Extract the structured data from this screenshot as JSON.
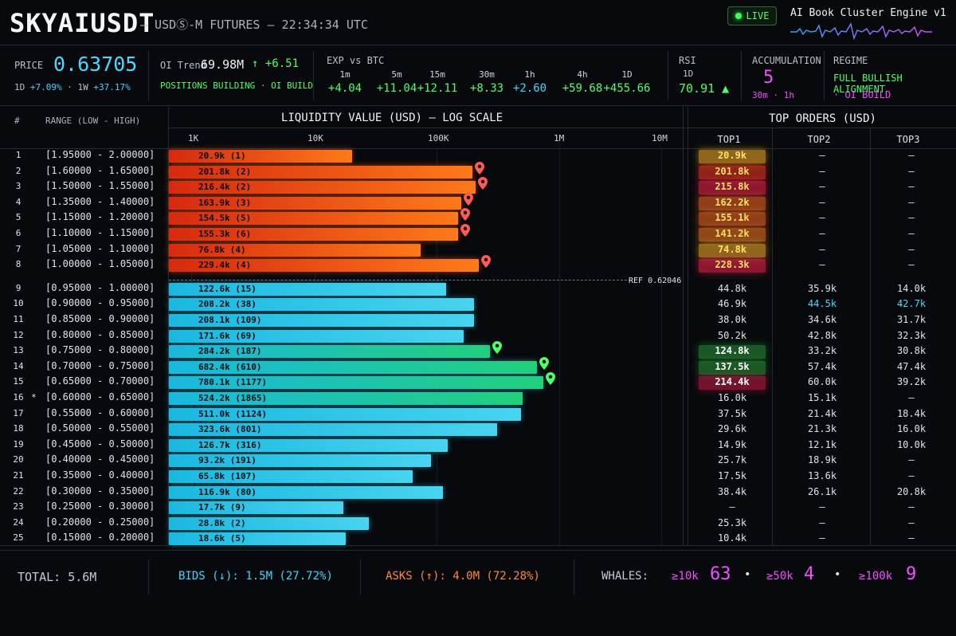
{
  "header": {
    "symbol": "SKYAIUSDT",
    "subtitle": "— USDⓈ-M FUTURES — 22:34:34 UTC",
    "live": "LIVE",
    "engine": "AI Book Cluster Engine v1"
  },
  "stats": {
    "price_label": "PRICE",
    "price": "0.63705",
    "change_1d_label": "1D",
    "change_1d": "+7.09%",
    "change_1w_label": "1W",
    "change_1w": "+37.17%",
    "oi_label": "OI Trend",
    "oi_value": "69.98M",
    "oi_delta": "↑ +6.51",
    "oi_status": "POSITIONS BUILDING · OI BUILD",
    "exp_label": "EXP vs BTC",
    "exp": [
      {
        "tf": "1m",
        "value": "+4.04",
        "color": "#4dff6a"
      },
      {
        "tf": "5m",
        "value": "+11.04",
        "color": "#4dff6a"
      },
      {
        "tf": "15m",
        "value": "+12.11",
        "color": "#4dff6a"
      },
      {
        "tf": "30m",
        "value": "+8.33",
        "color": "#4dff6a"
      },
      {
        "tf": "1h",
        "value": "+2.60",
        "color": "#3fd7ff"
      },
      {
        "tf": "4h",
        "value": "+59.68",
        "color": "#4dff6a"
      },
      {
        "tf": "1D",
        "value": "+455.66",
        "color": "#4dff6a"
      }
    ],
    "rsi_label": "RSI",
    "rsi_tf": "1D",
    "rsi_value": "70.91 ▲",
    "acc_label": "ACCUMULATION",
    "acc_value": "5",
    "acc_tf": "30m · 1h",
    "regime_label": "REGIME",
    "regime_value": "FULL BULLISH ALIGNMENT",
    "regime_sub": "· OI BUILD"
  },
  "table": {
    "col_index": "#",
    "col_range": "RANGE (LOW - HIGH)",
    "chart_title": "LIQUIDITY VALUE (USD) — LOG SCALE",
    "ticks": [
      "1K",
      "10K",
      "100K",
      "1M",
      "10M"
    ],
    "top_title": "TOP ORDERS (USD)",
    "top_cols": [
      "TOP1",
      "TOP2",
      "TOP3"
    ],
    "ref_label": "REF 0.62046"
  },
  "rows": [
    {
      "idx": "1",
      "range": "[1.95000 - 2.00000]",
      "label": "20.9k (1)",
      "value": 20900,
      "side": "ask",
      "pin": false,
      "t1": "20.9k",
      "t2": "–",
      "t3": "–",
      "hl": "#ffb22a"
    },
    {
      "idx": "2",
      "range": "[1.60000 - 1.65000]",
      "label": "201.8k (2)",
      "value": 201800,
      "side": "ask",
      "pin": true,
      "t1": "201.8k",
      "t2": "–",
      "t3": "–",
      "hl": "#ff3a22"
    },
    {
      "idx": "3",
      "range": "[1.50000 - 1.55000]",
      "label": "216.4k (2)",
      "value": 216400,
      "side": "ask",
      "pin": true,
      "t1": "215.8k",
      "t2": "–",
      "t3": "–",
      "hl": "#ff2250"
    },
    {
      "idx": "4",
      "range": "[1.35000 - 1.40000]",
      "label": "163.9k (3)",
      "value": 163900,
      "side": "ask",
      "pin": true,
      "t1": "162.2k",
      "t2": "–",
      "t3": "–",
      "hl": "#ff6a22"
    },
    {
      "idx": "5",
      "range": "[1.15000 - 1.20000]",
      "label": "154.5k (5)",
      "value": 154500,
      "side": "ask",
      "pin": true,
      "t1": "155.1k",
      "t2": "–",
      "t3": "–",
      "hl": "#ff6a22"
    },
    {
      "idx": "6",
      "range": "[1.10000 - 1.15000]",
      "label": "155.3k (6)",
      "value": 155300,
      "side": "ask",
      "pin": true,
      "t1": "141.2k",
      "t2": "–",
      "t3": "–",
      "hl": "#ff7a22"
    },
    {
      "idx": "7",
      "range": "[1.05000 - 1.10000]",
      "label": "76.8k (4)",
      "value": 76800,
      "side": "ask",
      "pin": false,
      "t1": "74.8k",
      "t2": "–",
      "t3": "–",
      "hl": "#ffb22a"
    },
    {
      "idx": "8",
      "range": "[1.00000 - 1.05000]",
      "label": "229.4k (4)",
      "value": 229400,
      "side": "ask",
      "pin": true,
      "t1": "228.3k",
      "t2": "–",
      "t3": "–",
      "hl": "#ff2250"
    },
    {
      "idx": "9",
      "range": "[0.95000 - 1.00000]",
      "label": "122.6k (15)",
      "value": 122600,
      "side": "bid",
      "pin": false,
      "t1": "44.8k",
      "t2": "35.9k",
      "t3": "14.0k",
      "hl": ""
    },
    {
      "idx": "10",
      "range": "[0.90000 - 0.95000]",
      "label": "208.2k (38)",
      "value": 208200,
      "side": "bid",
      "pin": false,
      "t1": "46.9k",
      "t2": "44.5k",
      "t3": "42.7k",
      "hl": ""
    },
    {
      "idx": "11",
      "range": "[0.85000 - 0.90000]",
      "label": "208.1k (109)",
      "value": 208100,
      "side": "bid",
      "pin": false,
      "t1": "38.0k",
      "t2": "34.6k",
      "t3": "31.7k",
      "hl": ""
    },
    {
      "idx": "12",
      "range": "[0.80000 - 0.85000]",
      "label": "171.6k (69)",
      "value": 171600,
      "side": "bid",
      "pin": false,
      "t1": "50.2k",
      "t2": "42.8k",
      "t3": "32.3k",
      "hl": ""
    },
    {
      "idx": "13",
      "range": "[0.75000 - 0.80000]",
      "label": "284.2k (187)",
      "value": 284200,
      "side": "bid",
      "pin": true,
      "t1": "124.8k",
      "t2": "33.2k",
      "t3": "30.8k",
      "hl": "#2a9a3a"
    },
    {
      "idx": "14",
      "range": "[0.70000 - 0.75000]",
      "label": "682.4k (610)",
      "value": 682400,
      "side": "bid",
      "pin": true,
      "t1": "137.5k",
      "t2": "57.4k",
      "t3": "47.4k",
      "hl": "#2a9a3a"
    },
    {
      "idx": "15",
      "range": "[0.65000 - 0.70000]",
      "label": "780.1k (1177)",
      "value": 780100,
      "side": "bid",
      "pin": true,
      "t1": "214.4k",
      "t2": "60.0k",
      "t3": "39.2k",
      "hl": "#d01a4a"
    },
    {
      "idx": "16",
      "star": "*",
      "range": "[0.60000 - 0.65000]",
      "label": "524.2k (1865)",
      "value": 524200,
      "side": "bid",
      "pin": false,
      "t1": "16.0k",
      "t2": "15.1k",
      "t3": "–",
      "hl": ""
    },
    {
      "idx": "17",
      "range": "[0.55000 - 0.60000]",
      "label": "511.0k (1124)",
      "value": 511000,
      "side": "bid",
      "pin": false,
      "t1": "37.5k",
      "t2": "21.4k",
      "t3": "18.4k",
      "hl": ""
    },
    {
      "idx": "18",
      "range": "[0.50000 - 0.55000]",
      "label": "323.6k (801)",
      "value": 323600,
      "side": "bid",
      "pin": false,
      "t1": "29.6k",
      "t2": "21.3k",
      "t3": "16.0k",
      "hl": ""
    },
    {
      "idx": "19",
      "range": "[0.45000 - 0.50000]",
      "label": "126.7k (316)",
      "value": 126700,
      "side": "bid",
      "pin": false,
      "t1": "14.9k",
      "t2": "12.1k",
      "t3": "10.0k",
      "hl": ""
    },
    {
      "idx": "20",
      "range": "[0.40000 - 0.45000]",
      "label": "93.2k (191)",
      "value": 93200,
      "side": "bid",
      "pin": false,
      "t1": "25.7k",
      "t2": "18.9k",
      "t3": "–",
      "hl": ""
    },
    {
      "idx": "21",
      "range": "[0.35000 - 0.40000]",
      "label": "65.8k (107)",
      "value": 65800,
      "side": "bid",
      "pin": false,
      "t1": "17.5k",
      "t2": "13.6k",
      "t3": "–",
      "hl": ""
    },
    {
      "idx": "22",
      "range": "[0.30000 - 0.35000]",
      "label": "116.9k (80)",
      "value": 116900,
      "side": "bid",
      "pin": false,
      "t1": "38.4k",
      "t2": "26.1k",
      "t3": "20.8k",
      "hl": ""
    },
    {
      "idx": "23",
      "range": "[0.25000 - 0.30000]",
      "label": "17.7k (9)",
      "value": 17700,
      "side": "bid",
      "pin": false,
      "t1": "–",
      "t2": "–",
      "t3": "–",
      "hl": ""
    },
    {
      "idx": "24",
      "range": "[0.20000 - 0.25000]",
      "label": "28.8k (2)",
      "value": 28800,
      "side": "bid",
      "pin": false,
      "t1": "25.3k",
      "t2": "–",
      "t3": "–",
      "hl": ""
    },
    {
      "idx": "25",
      "range": "[0.15000 - 0.20000]",
      "label": "18.6k (5)",
      "value": 18600,
      "side": "bid",
      "pin": false,
      "t1": "10.4k",
      "t2": "–",
      "t3": "–",
      "hl": ""
    }
  ],
  "footer": {
    "total": "TOTAL: 5.6M",
    "bids": "BIDS (↓): 1.5M (27.72%)",
    "asks": "ASKS (↑): 4.0M (72.28%)",
    "whales_label": "WHALES:",
    "whales": [
      {
        "k": "≥10k",
        "v": "63"
      },
      {
        "k": "≥50k",
        "v": "4"
      },
      {
        "k": "≥100k",
        "v": "9"
      }
    ]
  },
  "colors": {
    "ask_start": "#d62a10",
    "ask_end": "#ff7a1a",
    "bid_cyan": "#1ab8e0",
    "bid_green": "#22d07a",
    "accent": "#49d9ff",
    "pink": "#f24fff"
  },
  "chart_data": {
    "type": "bar",
    "title": "LIQUIDITY VALUE (USD) — LOG SCALE",
    "scale": "log",
    "xlim": [
      1000,
      10000000
    ],
    "tick_labels": [
      "1K",
      "10K",
      "100K",
      "1M",
      "10M"
    ],
    "categories": [
      "[1.95000 - 2.00000]",
      "[1.60000 - 1.65000]",
      "[1.50000 - 1.55000]",
      "[1.35000 - 1.40000]",
      "[1.15000 - 1.20000]",
      "[1.10000 - 1.15000]",
      "[1.05000 - 1.10000]",
      "[1.00000 - 1.05000]",
      "[0.95000 - 1.00000]",
      "[0.90000 - 0.95000]",
      "[0.85000 - 0.90000]",
      "[0.80000 - 0.85000]",
      "[0.75000 - 0.80000]",
      "[0.70000 - 0.75000]",
      "[0.65000 - 0.70000]",
      "[0.60000 - 0.65000]",
      "[0.55000 - 0.60000]",
      "[0.50000 - 0.55000]",
      "[0.45000 - 0.50000]",
      "[0.40000 - 0.45000]",
      "[0.35000 - 0.40000]",
      "[0.30000 - 0.35000]",
      "[0.25000 - 0.30000]",
      "[0.20000 - 0.25000]",
      "[0.15000 - 0.20000]"
    ],
    "values": [
      20900,
      201800,
      216400,
      163900,
      154500,
      155300,
      76800,
      229400,
      122600,
      208200,
      208100,
      171600,
      284200,
      682400,
      780100,
      524200,
      511000,
      323600,
      126700,
      93200,
      65800,
      116900,
      17700,
      28800,
      18600
    ],
    "orientation": "horizontal"
  }
}
